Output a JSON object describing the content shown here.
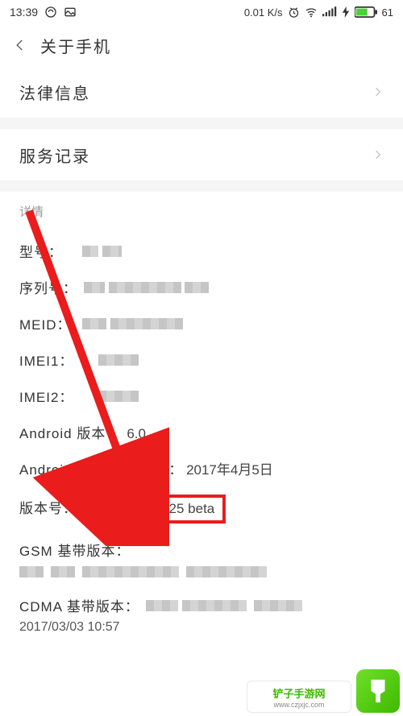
{
  "status": {
    "time": "13:39",
    "data_speed": "0.01 K/s",
    "battery": "61"
  },
  "header": {
    "title": "关于手机"
  },
  "nav": {
    "legal": "法律信息",
    "service": "服务记录"
  },
  "details_header": "详情",
  "details": {
    "model_label": "型号：",
    "serial_label": "序列号：",
    "meid_label": "MEID：",
    "imei1_label": "IMEI1：",
    "imei2_label": "IMEI2：",
    "android_ver_label": "Android 版本：",
    "android_ver_value": "6.0",
    "sec_patch_label_a": "Android 安全补",
    "sec_patch_label_b": "日期：",
    "sec_patch_value": "2017年4月5日",
    "build_label": "版本号：",
    "build_value": "Flyme 6.7.7.25 beta",
    "gsm_label": "GSM 基带版本：",
    "cdma_label": "CDMA 基带版本：",
    "cdma_line2": "2017/03/03 10:57"
  },
  "watermark": {
    "logo_text": "铲子",
    "site_name": "铲子手游网",
    "site_url": "www.czjxjc.com"
  }
}
